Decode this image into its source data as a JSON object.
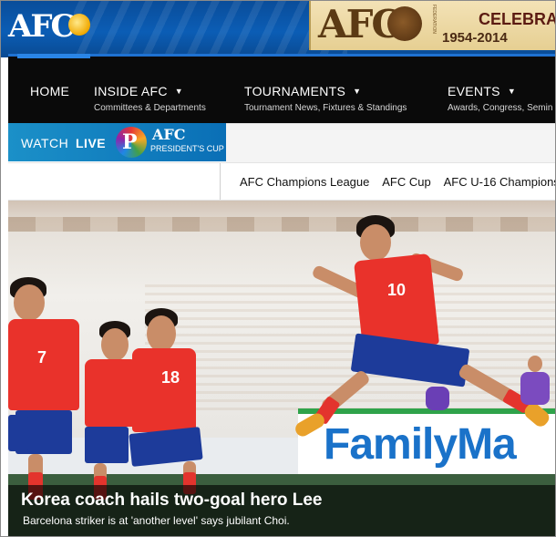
{
  "header": {
    "logo_text": "AFC",
    "banner": {
      "logo_text": "AFC",
      "title": "CELEBRA",
      "years": "1954-2014",
      "small_text": "FEDERATION"
    }
  },
  "nav": {
    "items": [
      {
        "label": "HOME",
        "sub": ""
      },
      {
        "label": "INSIDE AFC",
        "sub": "Committees & Departments"
      },
      {
        "label": "TOURNAMENTS",
        "sub": "Tournament News, Fixtures & Standings"
      },
      {
        "label": "EVENTS",
        "sub": "Awards, Congress, Semin"
      }
    ]
  },
  "watch_live": {
    "watch": "WATCH",
    "live": "LIVE",
    "logo_letter": "P",
    "brand": "AFC",
    "cup": "PRESIDENT'S CUP"
  },
  "tournaments": [
    "AFC Champions League",
    "AFC Cup",
    "AFC U-16 Champions"
  ],
  "hero": {
    "ad_text": "FamilyMa",
    "jersey_numbers": [
      "7",
      "18",
      "10"
    ],
    "headline": "Korea coach hails two-goal hero Lee",
    "subhead": "Barcelona striker is at 'another level' says jubilant Choi."
  },
  "colors": {
    "header_blue": "#0b5db5",
    "nav_black": "#0a0a0a",
    "accent_blue": "#1f72d2",
    "watch_blue": "#1b90c8",
    "kit_red": "#e9322b",
    "kit_blue": "#1d3b9a"
  }
}
